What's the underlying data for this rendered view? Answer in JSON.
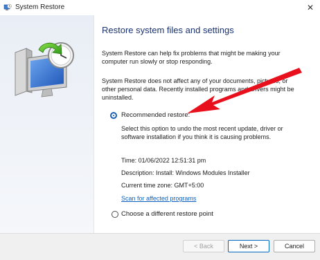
{
  "window": {
    "title": "System Restore",
    "close_glyph": "✕"
  },
  "header": {
    "title": "Restore system files and settings"
  },
  "body": {
    "para1": "System Restore can help fix problems that might be making your computer run slowly or stop responding.",
    "para2": "System Restore does not affect any of your documents, pictures, or other personal data. Recently installed programs and drivers might be uninstalled."
  },
  "options": {
    "recommended": {
      "label": "Recommended restore:",
      "description": "Select this option to undo the most recent update, driver or software installation if you think it is causing problems.",
      "time": "Time: 01/06/2022 12:51:31 pm",
      "desc": "Description: Install: Windows Modules Installer",
      "timezone": "Current time zone: GMT+5:00",
      "scan_link": "Scan for affected programs",
      "selected": true
    },
    "different": {
      "label": "Choose a different restore point",
      "selected": false
    }
  },
  "buttons": {
    "back": "< Back",
    "next": "Next >",
    "cancel": "Cancel"
  },
  "colors": {
    "heading": "#1a3370",
    "link": "#0b5fbf",
    "accent": "#1a5fb4",
    "annotation_arrow": "#e8101c"
  },
  "icons": {
    "app": "system-restore-icon",
    "hero": "computer-clock-restore-icon",
    "annotation": "red-arrow"
  }
}
